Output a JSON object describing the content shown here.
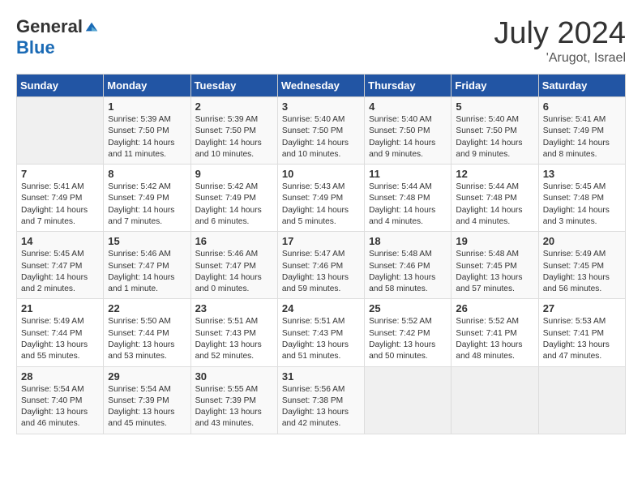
{
  "header": {
    "logo_general": "General",
    "logo_blue": "Blue",
    "month_title": "July 2024",
    "location": "'Arugot, Israel"
  },
  "weekdays": [
    "Sunday",
    "Monday",
    "Tuesday",
    "Wednesday",
    "Thursday",
    "Friday",
    "Saturday"
  ],
  "weeks": [
    [
      {
        "day": "",
        "sunrise": "",
        "sunset": "",
        "daylight": ""
      },
      {
        "day": "1",
        "sunrise": "Sunrise: 5:39 AM",
        "sunset": "Sunset: 7:50 PM",
        "daylight": "Daylight: 14 hours and 11 minutes."
      },
      {
        "day": "2",
        "sunrise": "Sunrise: 5:39 AM",
        "sunset": "Sunset: 7:50 PM",
        "daylight": "Daylight: 14 hours and 10 minutes."
      },
      {
        "day": "3",
        "sunrise": "Sunrise: 5:40 AM",
        "sunset": "Sunset: 7:50 PM",
        "daylight": "Daylight: 14 hours and 10 minutes."
      },
      {
        "day": "4",
        "sunrise": "Sunrise: 5:40 AM",
        "sunset": "Sunset: 7:50 PM",
        "daylight": "Daylight: 14 hours and 9 minutes."
      },
      {
        "day": "5",
        "sunrise": "Sunrise: 5:40 AM",
        "sunset": "Sunset: 7:50 PM",
        "daylight": "Daylight: 14 hours and 9 minutes."
      },
      {
        "day": "6",
        "sunrise": "Sunrise: 5:41 AM",
        "sunset": "Sunset: 7:49 PM",
        "daylight": "Daylight: 14 hours and 8 minutes."
      }
    ],
    [
      {
        "day": "7",
        "sunrise": "Sunrise: 5:41 AM",
        "sunset": "Sunset: 7:49 PM",
        "daylight": "Daylight: 14 hours and 7 minutes."
      },
      {
        "day": "8",
        "sunrise": "Sunrise: 5:42 AM",
        "sunset": "Sunset: 7:49 PM",
        "daylight": "Daylight: 14 hours and 7 minutes."
      },
      {
        "day": "9",
        "sunrise": "Sunrise: 5:42 AM",
        "sunset": "Sunset: 7:49 PM",
        "daylight": "Daylight: 14 hours and 6 minutes."
      },
      {
        "day": "10",
        "sunrise": "Sunrise: 5:43 AM",
        "sunset": "Sunset: 7:49 PM",
        "daylight": "Daylight: 14 hours and 5 minutes."
      },
      {
        "day": "11",
        "sunrise": "Sunrise: 5:44 AM",
        "sunset": "Sunset: 7:48 PM",
        "daylight": "Daylight: 14 hours and 4 minutes."
      },
      {
        "day": "12",
        "sunrise": "Sunrise: 5:44 AM",
        "sunset": "Sunset: 7:48 PM",
        "daylight": "Daylight: 14 hours and 4 minutes."
      },
      {
        "day": "13",
        "sunrise": "Sunrise: 5:45 AM",
        "sunset": "Sunset: 7:48 PM",
        "daylight": "Daylight: 14 hours and 3 minutes."
      }
    ],
    [
      {
        "day": "14",
        "sunrise": "Sunrise: 5:45 AM",
        "sunset": "Sunset: 7:47 PM",
        "daylight": "Daylight: 14 hours and 2 minutes."
      },
      {
        "day": "15",
        "sunrise": "Sunrise: 5:46 AM",
        "sunset": "Sunset: 7:47 PM",
        "daylight": "Daylight: 14 hours and 1 minute."
      },
      {
        "day": "16",
        "sunrise": "Sunrise: 5:46 AM",
        "sunset": "Sunset: 7:47 PM",
        "daylight": "Daylight: 14 hours and 0 minutes."
      },
      {
        "day": "17",
        "sunrise": "Sunrise: 5:47 AM",
        "sunset": "Sunset: 7:46 PM",
        "daylight": "Daylight: 13 hours and 59 minutes."
      },
      {
        "day": "18",
        "sunrise": "Sunrise: 5:48 AM",
        "sunset": "Sunset: 7:46 PM",
        "daylight": "Daylight: 13 hours and 58 minutes."
      },
      {
        "day": "19",
        "sunrise": "Sunrise: 5:48 AM",
        "sunset": "Sunset: 7:45 PM",
        "daylight": "Daylight: 13 hours and 57 minutes."
      },
      {
        "day": "20",
        "sunrise": "Sunrise: 5:49 AM",
        "sunset": "Sunset: 7:45 PM",
        "daylight": "Daylight: 13 hours and 56 minutes."
      }
    ],
    [
      {
        "day": "21",
        "sunrise": "Sunrise: 5:49 AM",
        "sunset": "Sunset: 7:44 PM",
        "daylight": "Daylight: 13 hours and 55 minutes."
      },
      {
        "day": "22",
        "sunrise": "Sunrise: 5:50 AM",
        "sunset": "Sunset: 7:44 PM",
        "daylight": "Daylight: 13 hours and 53 minutes."
      },
      {
        "day": "23",
        "sunrise": "Sunrise: 5:51 AM",
        "sunset": "Sunset: 7:43 PM",
        "daylight": "Daylight: 13 hours and 52 minutes."
      },
      {
        "day": "24",
        "sunrise": "Sunrise: 5:51 AM",
        "sunset": "Sunset: 7:43 PM",
        "daylight": "Daylight: 13 hours and 51 minutes."
      },
      {
        "day": "25",
        "sunrise": "Sunrise: 5:52 AM",
        "sunset": "Sunset: 7:42 PM",
        "daylight": "Daylight: 13 hours and 50 minutes."
      },
      {
        "day": "26",
        "sunrise": "Sunrise: 5:52 AM",
        "sunset": "Sunset: 7:41 PM",
        "daylight": "Daylight: 13 hours and 48 minutes."
      },
      {
        "day": "27",
        "sunrise": "Sunrise: 5:53 AM",
        "sunset": "Sunset: 7:41 PM",
        "daylight": "Daylight: 13 hours and 47 minutes."
      }
    ],
    [
      {
        "day": "28",
        "sunrise": "Sunrise: 5:54 AM",
        "sunset": "Sunset: 7:40 PM",
        "daylight": "Daylight: 13 hours and 46 minutes."
      },
      {
        "day": "29",
        "sunrise": "Sunrise: 5:54 AM",
        "sunset": "Sunset: 7:39 PM",
        "daylight": "Daylight: 13 hours and 45 minutes."
      },
      {
        "day": "30",
        "sunrise": "Sunrise: 5:55 AM",
        "sunset": "Sunset: 7:39 PM",
        "daylight": "Daylight: 13 hours and 43 minutes."
      },
      {
        "day": "31",
        "sunrise": "Sunrise: 5:56 AM",
        "sunset": "Sunset: 7:38 PM",
        "daylight": "Daylight: 13 hours and 42 minutes."
      },
      {
        "day": "",
        "sunrise": "",
        "sunset": "",
        "daylight": ""
      },
      {
        "day": "",
        "sunrise": "",
        "sunset": "",
        "daylight": ""
      },
      {
        "day": "",
        "sunrise": "",
        "sunset": "",
        "daylight": ""
      }
    ]
  ]
}
